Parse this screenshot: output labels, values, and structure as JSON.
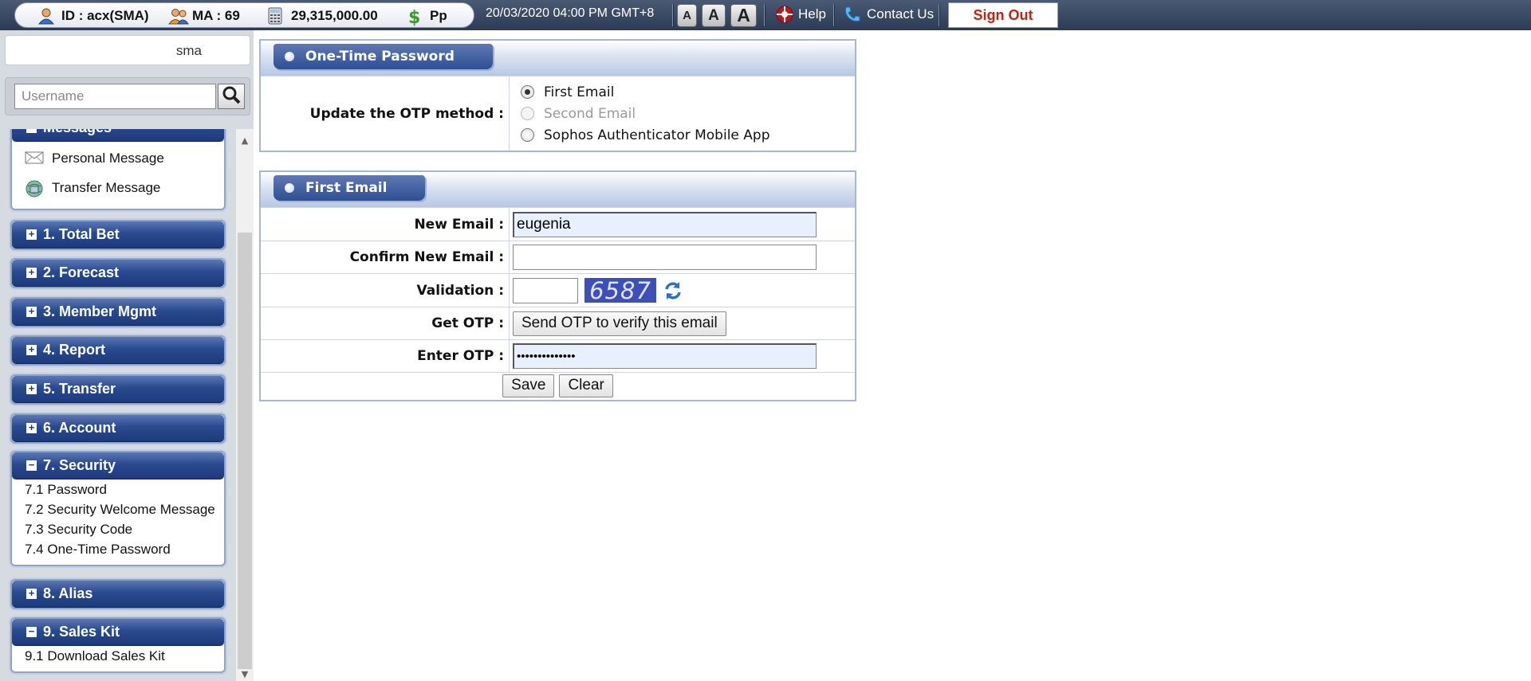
{
  "topbar": {
    "user_id": "ID : acx(SMA)",
    "ma": "MA : 69",
    "balance": "29,315,000.00",
    "currency": "Pp",
    "datetime": "20/03/2020 04:00 PM GMT+8",
    "font_small": "A",
    "font_medium": "A",
    "font_large": "A",
    "help": "Help",
    "contact": "Contact Us",
    "signout": "Sign Out"
  },
  "sidebar": {
    "user": "sma",
    "search_placeholder": "Username",
    "messages": {
      "title": "Messages",
      "items": [
        "Personal Message",
        "Transfer Message"
      ]
    },
    "menu": [
      {
        "label": "1. Total Bet"
      },
      {
        "label": "2. Forecast"
      },
      {
        "label": "3. Member Mgmt"
      },
      {
        "label": "4. Report"
      },
      {
        "label": "5. Transfer"
      },
      {
        "label": "6. Account"
      },
      {
        "label": "7. Security",
        "items": [
          "7.1 Password",
          "7.2 Security Welcome Message",
          "7.3 Security Code",
          "7.4 One-Time Password"
        ]
      },
      {
        "label": "8. Alias"
      },
      {
        "label": "9. Sales Kit",
        "items": [
          "9.1 Download Sales Kit"
        ]
      }
    ]
  },
  "otp_panel": {
    "title": "One-Time Password",
    "method_label": "Update the OTP method :",
    "options": [
      "First Email",
      "Second Email",
      "Sophos Authenticator Mobile App"
    ],
    "selected": "First Email",
    "disabled": "Second Email"
  },
  "email_panel": {
    "title": "First Email",
    "new_email_label": "New Email :",
    "new_email_value": "eugenia",
    "confirm_label": "Confirm New Email :",
    "confirm_value": "",
    "validation_label": "Validation :",
    "captcha": "6587",
    "get_otp_label": "Get OTP :",
    "send_otp_button": "Send OTP to verify this email",
    "enter_otp_label": "Enter OTP :",
    "otp_value": "••••••••••••••",
    "save": "Save",
    "clear": "Clear"
  },
  "colors": {
    "menu_head": "#2a4a8f",
    "signout_text": "#c8200e",
    "topbar": "#2c3b55"
  }
}
